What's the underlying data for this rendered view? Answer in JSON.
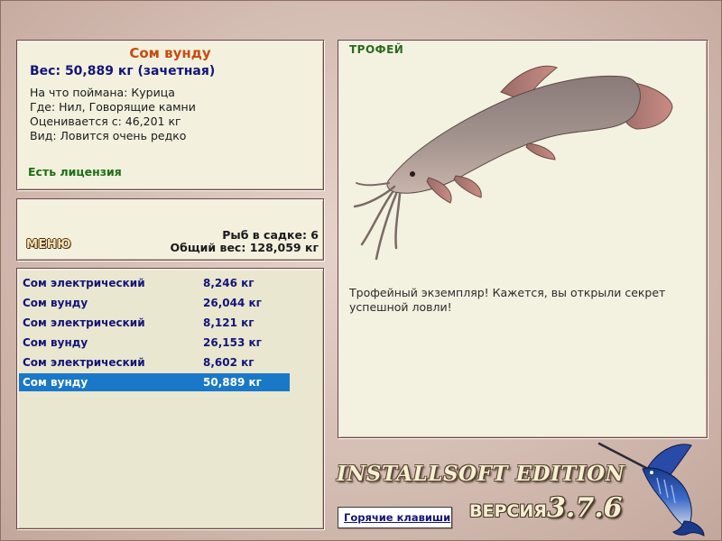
{
  "info": {
    "fish_name": "Сом вунду",
    "weight": "Вес: 50,889 кг (зачетная)",
    "bait": "На что поймана: Курица",
    "location": "Где: Нил, Говорящие камни",
    "estimated": "Оценивается с: 46,201 кг",
    "rarity": "Вид: Ловится очень редко",
    "license": "Есть лицензия"
  },
  "menu": {
    "button_label": "МЕНЮ",
    "keep_count": "Рыб в садке: 6",
    "total_weight": "Общий вес: 128,059 кг"
  },
  "catch_list": [
    {
      "name": "Сом электрический",
      "weight": "8,246 кг",
      "selected": false
    },
    {
      "name": "Сом вунду",
      "weight": "26,044 кг",
      "selected": false
    },
    {
      "name": "Сом электрический",
      "weight": "8,121 кг",
      "selected": false
    },
    {
      "name": "Сом вунду",
      "weight": "26,153 кг",
      "selected": false
    },
    {
      "name": "Сом электрический",
      "weight": "8,602 кг",
      "selected": false
    },
    {
      "name": "Сом вунду",
      "weight": "50,889 кг",
      "selected": true
    }
  ],
  "trophy": {
    "label": "ТРОФЕЙ",
    "text": "Трофейный экземпляр! Кажется, вы открыли секрет успешной ловли!"
  },
  "footer": {
    "edition": "INSTALLSOFT EDITION",
    "hotkeys": "Горячие клавиши",
    "version_label": "ВЕРСИЯ",
    "version_number": "3.7.6"
  },
  "colors": {
    "fish_name": "#c84a10",
    "weight": "#141478",
    "license": "#1c6e14",
    "selected_row": "#1a78c8",
    "panel_bg": "#f3f1de"
  },
  "icons": {
    "fish_image": "catfish-icon",
    "logo": "marlin-icon"
  }
}
